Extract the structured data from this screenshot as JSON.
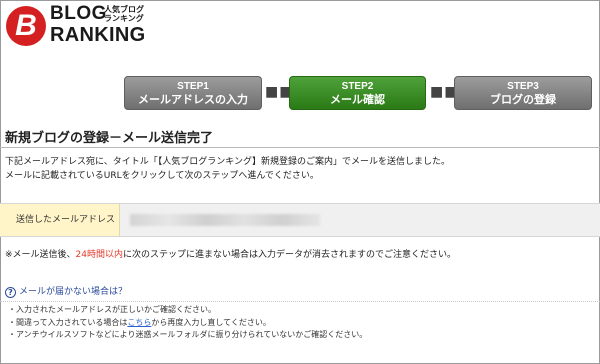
{
  "logo": {
    "badge": "B",
    "line1": "BLOG",
    "line2": "RANKING",
    "jp_tag_1": "人気ブログ",
    "jp_tag_2": "ランキング"
  },
  "steps": [
    {
      "num": "STEP1",
      "name": "メールアドレスの入力",
      "active": false
    },
    {
      "num": "STEP2",
      "name": "メール確認",
      "active": true
    },
    {
      "num": "STEP3",
      "name": "ブログの登録",
      "active": false
    }
  ],
  "step_separator": "■■■",
  "page_title": "新規ブログの登録－メール送信完了",
  "description": {
    "line1": "下記メールアドレス宛に、タイトル「【人気ブログランキング】新規登録のご案内」でメールを送信しました。",
    "line2": "メールに記載されているURLをクリックして次のステップへ進んでください。"
  },
  "email_row": {
    "label": "送信したメールアドレス"
  },
  "notice": {
    "before": "※メール送信後、",
    "highlight": "24時間以内",
    "after": "に次のステップに進まない場合は入力データが消去されますのでご注意ください。"
  },
  "help": {
    "icon": "?",
    "heading": "メールが届かない場合は？",
    "item1": "入力されたメールアドレスが正しいかご確認ください。",
    "item2_before": "間違って入力されている場合は",
    "item2_link": "こちら",
    "item2_after": "から再度入力し直してください。",
    "item3": "アンチウイルスソフトなどにより迷惑メールフォルダに振り分けられていないかご確認ください。"
  },
  "colors": {
    "step_active": "#2a7a16",
    "step_inactive": "#7a7a7a",
    "highlight_red": "#e23a2a",
    "link_blue": "#2a5fcc",
    "label_bg": "#fff5c8"
  }
}
